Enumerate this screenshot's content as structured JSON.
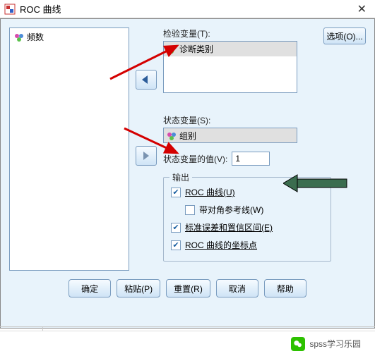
{
  "titlebar": {
    "title": "ROC 曲线"
  },
  "left_list": {
    "items": [
      {
        "label": "频数"
      }
    ]
  },
  "test_var": {
    "label": "检验变量(T):",
    "items": [
      {
        "label": "诊断类别"
      }
    ]
  },
  "state_var": {
    "label": "状态变量(S):",
    "items": [
      {
        "label": "组别"
      }
    ]
  },
  "state_value": {
    "label": "状态变量的值(V):",
    "value": "1"
  },
  "options_btn": "选项(O)...",
  "output_group": {
    "title": "输出",
    "roc_curve": {
      "label": "ROC 曲线(U)",
      "checked": true
    },
    "diag_ref": {
      "label": "带对角参考线(W)",
      "checked": false
    },
    "std_err_ci": {
      "label": "标准误差和置信区间(E)",
      "checked": true
    },
    "roc_coords": {
      "label": "ROC 曲线的坐标点",
      "checked": true
    }
  },
  "buttons": {
    "ok": "确定",
    "paste": "粘贴(P)",
    "reset": "重置(R)",
    "cancel": "取消",
    "help": "帮助"
  },
  "watermark": "spss学习乐园"
}
